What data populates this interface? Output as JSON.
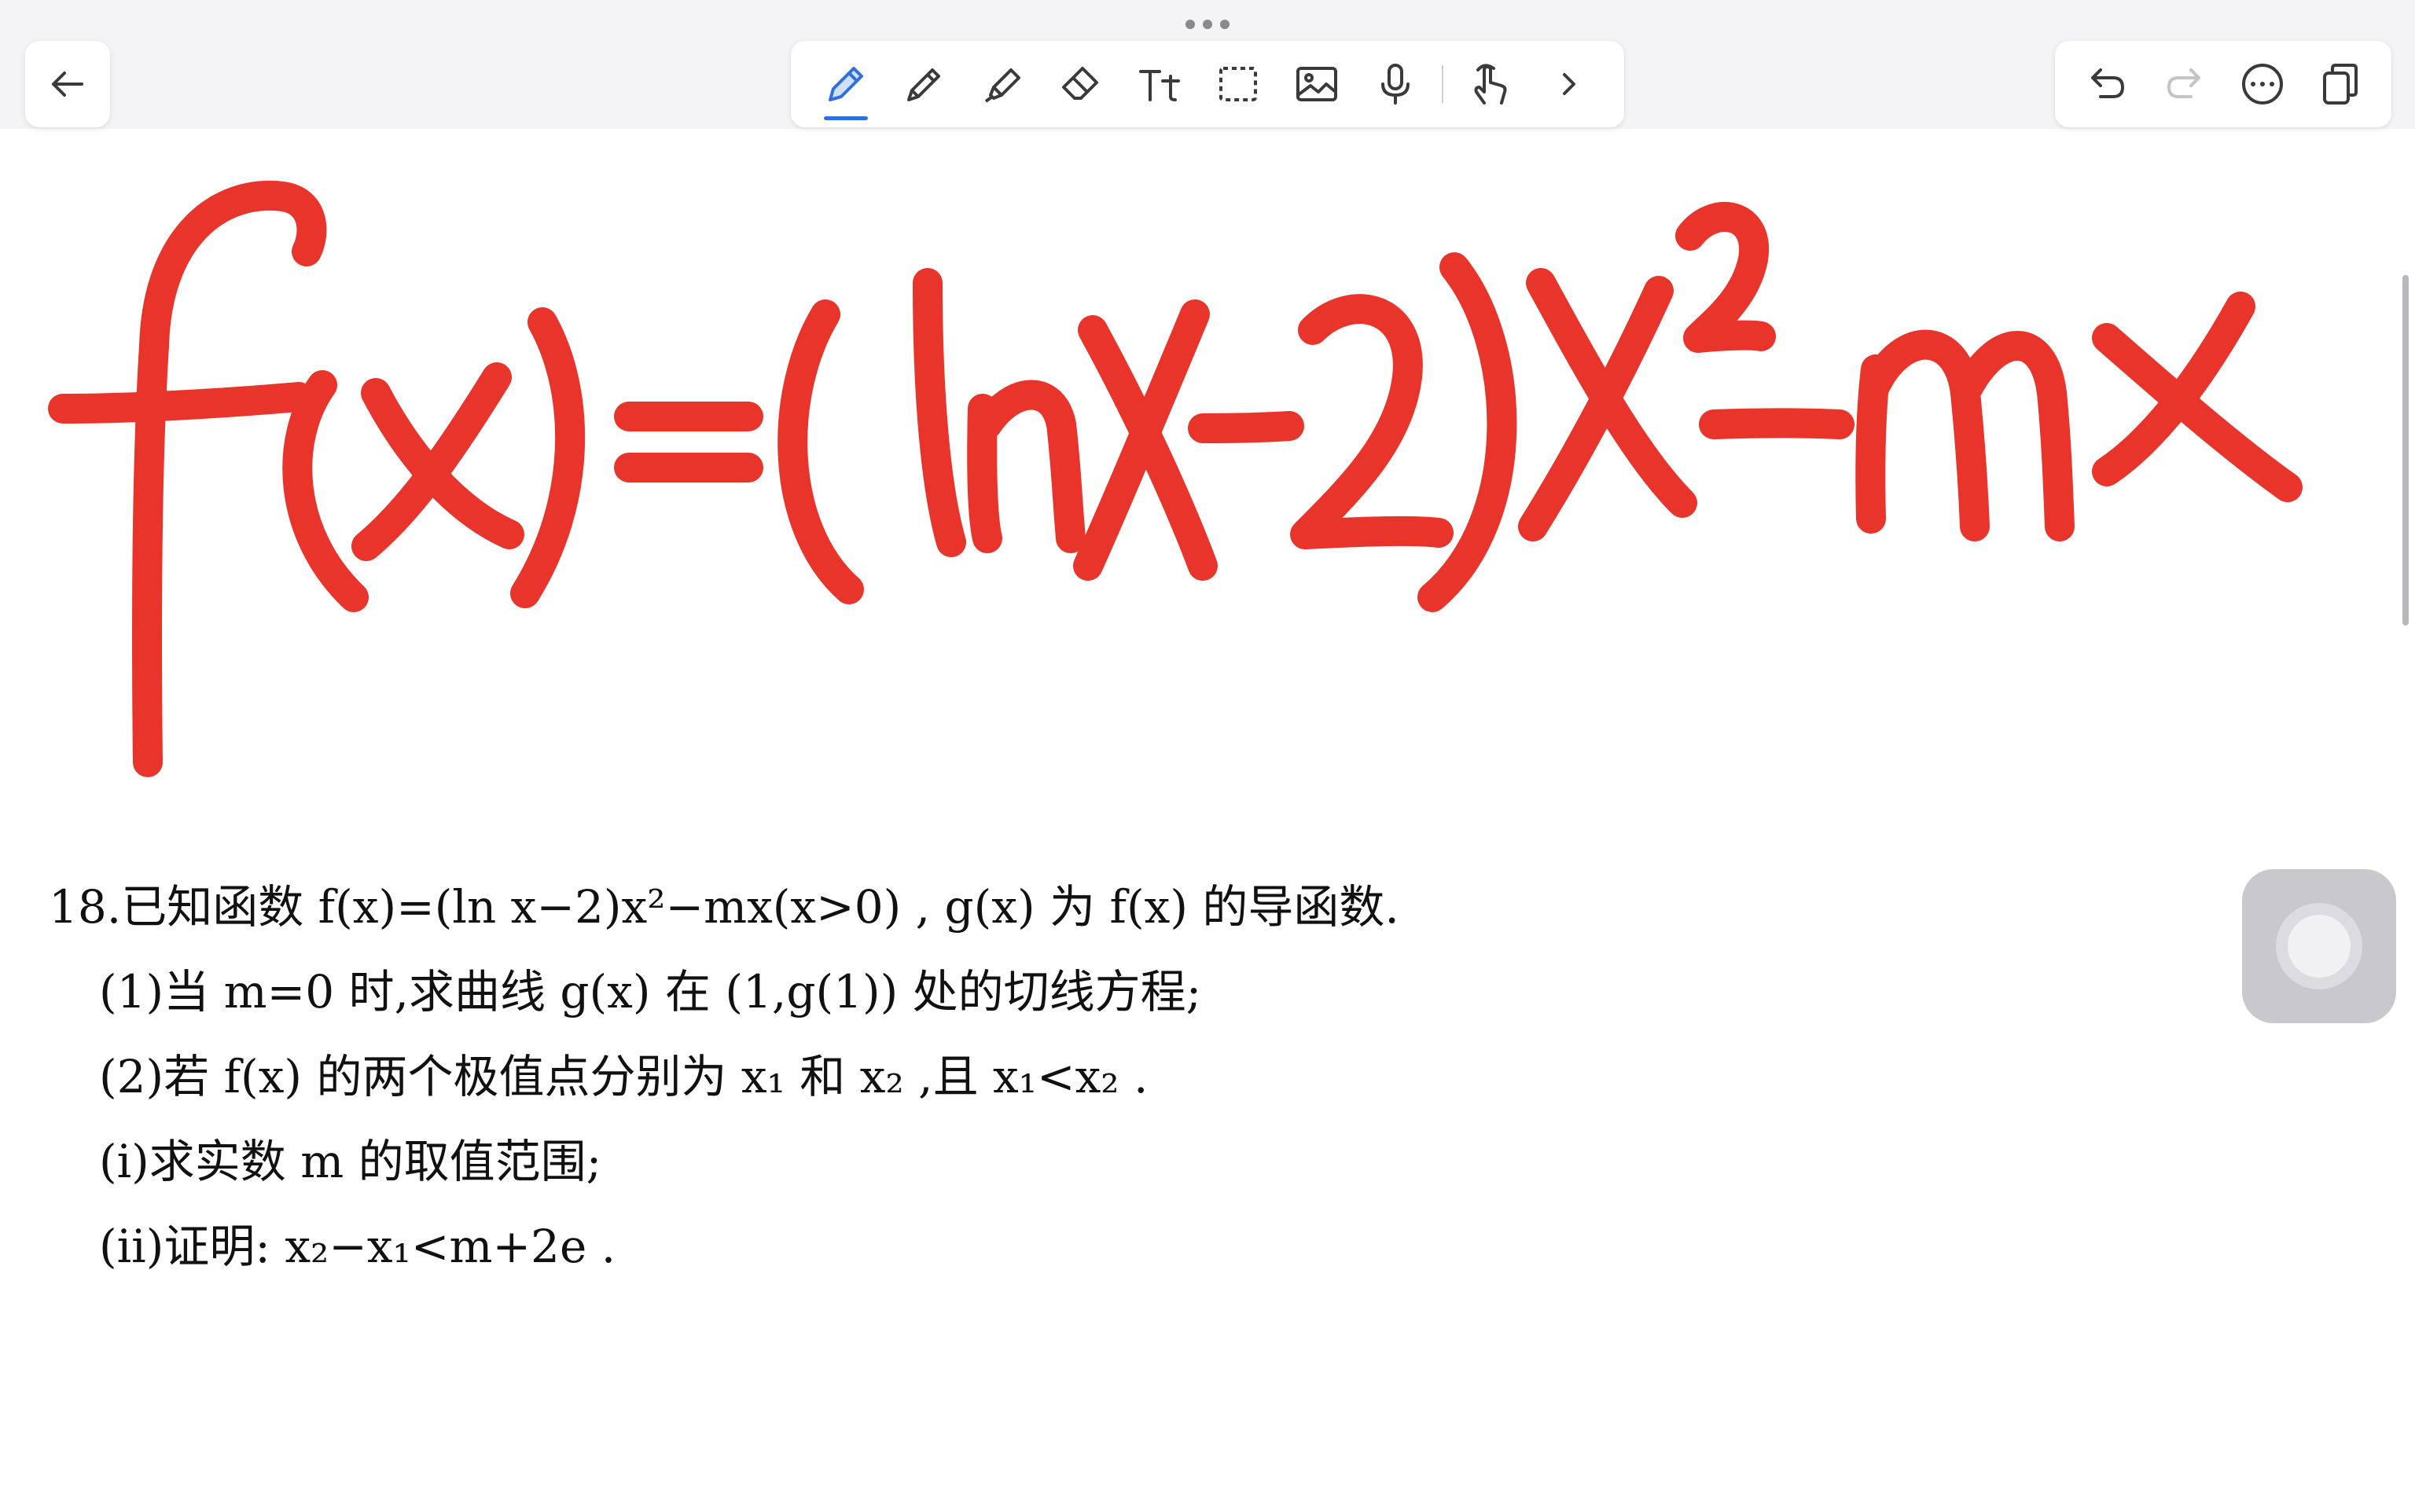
{
  "toolbar": {
    "back": "back-arrow-icon",
    "tools": [
      {
        "name": "pen-icon",
        "active": true
      },
      {
        "name": "pencil-icon"
      },
      {
        "name": "highlighter-icon"
      },
      {
        "name": "eraser-icon"
      },
      {
        "name": "text-icon",
        "label": "Tt"
      },
      {
        "name": "lasso-select-icon"
      },
      {
        "name": "image-icon"
      },
      {
        "name": "microphone-icon"
      },
      {
        "name": "hand-touch-icon"
      },
      {
        "name": "chevron-right-icon"
      }
    ],
    "right": [
      "undo-icon",
      "redo-icon",
      "more-icon",
      "pages-icon"
    ]
  },
  "colors": {
    "ink": "#e8342a",
    "accent": "#2f6fe0",
    "icon": "#3a3a3c"
  },
  "handwriting": {
    "expression": "f(x)=(lnx-2)x²-mx"
  },
  "problem": {
    "l1": "18.已知函数 f(x)=(ln x−2)x²−mx(x>0) , g(x) 为 f(x) 的导函数.",
    "l2": "(1)当 m=0 时,求曲线 g(x) 在 (1,g(1)) 处的切线方程;",
    "l3": "(2)若 f(x) 的两个极值点分别为 x₁ 和 x₂ ,且 x₁<x₂ .",
    "l4": "(i)求实数 m 的取值范围;",
    "l5": "(ii)证明: x₂−x₁<m+2e ."
  }
}
